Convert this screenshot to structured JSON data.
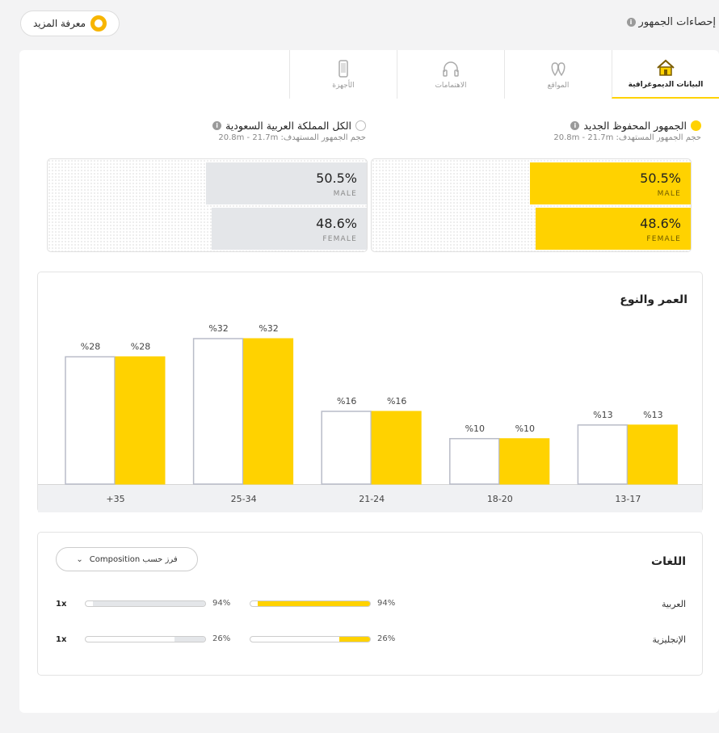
{
  "header": {
    "title": "إحصاءات الجمهور",
    "learn_more": "معرفة المزيد"
  },
  "tabs": [
    {
      "label": "البيانات الديموغرافية",
      "icon": "house-icon",
      "active": true
    },
    {
      "label": "المواقع",
      "icon": "location-pins-icon",
      "active": false
    },
    {
      "label": "الاهتمامات",
      "icon": "headphones-icon",
      "active": false
    },
    {
      "label": "الأجهزة",
      "icon": "phone-icon",
      "active": false
    }
  ],
  "audiences": {
    "primary": {
      "name": "الجمهور المحفوظ الجديد",
      "size": "حجم الجمهور المستهدف: 20.8m - 21.7m",
      "color": "#ffd200"
    },
    "comparison": {
      "name": "الكل المملكة العربية السعودية",
      "size": "حجم الجمهور المستهدف: 20.8m - 21.7m",
      "color": "#e4e6e9"
    }
  },
  "gender": {
    "primary": [
      {
        "value": "50.5%",
        "label": "MALE",
        "fraction": 0.505
      },
      {
        "value": "48.6%",
        "label": "FEMALE",
        "fraction": 0.486
      }
    ],
    "comparison": [
      {
        "value": "50.5%",
        "label": "MALE",
        "fraction": 0.505
      },
      {
        "value": "48.6%",
        "label": "FEMALE",
        "fraction": 0.486
      }
    ]
  },
  "age_section": {
    "title": "العمر والنوع"
  },
  "chart_data": {
    "type": "bar",
    "categories": [
      "+35",
      "25-34",
      "21-24",
      "18-20",
      "13-17"
    ],
    "series": [
      {
        "values": [
          28,
          32,
          16,
          10,
          13
        ],
        "labels": [
          "%28",
          "%32",
          "%16",
          "%10",
          "%13"
        ],
        "color": "#ffffff"
      },
      {
        "values": [
          28,
          32,
          16,
          10,
          13
        ],
        "labels": [
          "%28",
          "%32",
          "%16",
          "%10",
          "%13"
        ],
        "color": "#ffd200"
      }
    ],
    "ylim": [
      0,
      32
    ],
    "grid": false
  },
  "languages": {
    "title": "اللغات",
    "sort_label": "فرز حسب Composition",
    "rows": [
      {
        "name": "العربية",
        "multiplier": "1x",
        "comparison_pct": "94%",
        "comparison_value": 0.94,
        "primary_pct": "94%",
        "primary_value": 0.94
      },
      {
        "name": "الإنجليزية",
        "multiplier": "1x",
        "comparison_pct": "26%",
        "comparison_value": 0.26,
        "primary_pct": "26%",
        "primary_value": 0.26
      }
    ]
  }
}
